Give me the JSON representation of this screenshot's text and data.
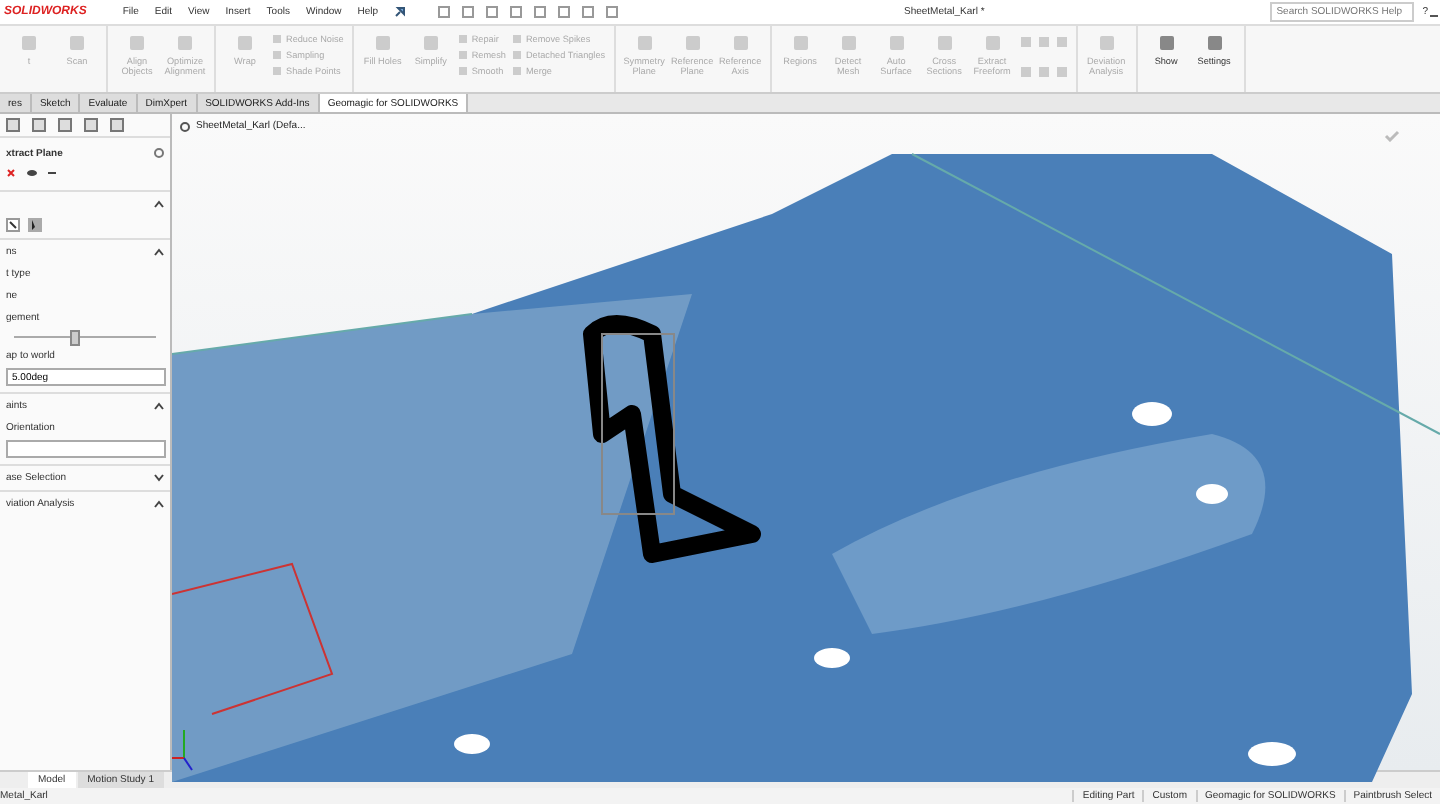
{
  "title_bar": {
    "logo": "SOLIDWORKS",
    "menu": [
      "File",
      "Edit",
      "View",
      "Insert",
      "Tools",
      "Window",
      "Help"
    ],
    "document_title": "SheetMetal_Karl *",
    "search": {
      "placeholder": "Search SOLIDWORKS Help"
    },
    "help": "?"
  },
  "ribbon": {
    "groups": [
      {
        "items": [
          {
            "kind": "large",
            "label": "t",
            "disabled": true
          },
          {
            "kind": "large",
            "label": "Scan",
            "disabled": true
          }
        ]
      },
      {
        "items": [
          {
            "kind": "large",
            "label": "Align Objects",
            "disabled": true
          },
          {
            "kind": "large",
            "label": "Optimize Alignment",
            "disabled": true
          }
        ]
      },
      {
        "items": [
          {
            "kind": "large",
            "label": "Wrap",
            "disabled": true
          },
          {
            "kind": "stack",
            "labels": [
              "Reduce Noise",
              "Sampling",
              "Shade Points"
            ],
            "disabled": true
          }
        ]
      },
      {
        "items": [
          {
            "kind": "large",
            "label": "Fill Holes",
            "disabled": true
          },
          {
            "kind": "large",
            "label": "Simplify",
            "disabled": true
          },
          {
            "kind": "stack",
            "labels": [
              "Repair",
              "Remesh",
              "Smooth"
            ],
            "disabled": true
          },
          {
            "kind": "stack",
            "labels": [
              "Remove Spikes",
              "Detached Triangles",
              "Merge"
            ],
            "disabled": true
          }
        ]
      },
      {
        "items": [
          {
            "kind": "large",
            "label": "Symmetry Plane",
            "disabled": true
          },
          {
            "kind": "large",
            "label": "Reference Plane",
            "disabled": true
          },
          {
            "kind": "large",
            "label": "Reference Axis",
            "disabled": true
          }
        ]
      },
      {
        "items": [
          {
            "kind": "large",
            "label": "Regions",
            "disabled": true
          },
          {
            "kind": "large",
            "label": "Detect Mesh",
            "disabled": true
          },
          {
            "kind": "large",
            "label": "Auto Surface",
            "disabled": true
          },
          {
            "kind": "large",
            "label": "Cross Sections",
            "disabled": true
          },
          {
            "kind": "large",
            "label": "Extract Freeform",
            "disabled": true
          },
          {
            "kind": "icons",
            "disabled": true
          }
        ]
      },
      {
        "items": [
          {
            "kind": "large",
            "label": "Deviation Analysis",
            "disabled": true
          }
        ]
      },
      {
        "items": [
          {
            "kind": "large",
            "label": "Show",
            "disabled": false
          },
          {
            "kind": "large",
            "label": "Settings",
            "disabled": false
          }
        ]
      }
    ]
  },
  "command_tabs": [
    {
      "label": "res",
      "selected": false
    },
    {
      "label": "Sketch",
      "selected": false
    },
    {
      "label": "Evaluate",
      "selected": false
    },
    {
      "label": "DimXpert",
      "selected": false
    },
    {
      "label": "SOLIDWORKS Add-Ins",
      "selected": false
    },
    {
      "label": "Geomagic for SOLIDWORKS",
      "selected": true
    }
  ],
  "property_panel": {
    "title": "xtract Plane",
    "sections": [
      {
        "expanded": true
      },
      {
        "title": "ns",
        "expanded": true,
        "rows": [
          {
            "kind": "label",
            "text": "t type"
          },
          {
            "kind": "label",
            "text": "ne"
          },
          {
            "kind": "label",
            "text": "gement"
          },
          {
            "kind": "slider",
            "level": 0.4
          },
          {
            "kind": "label",
            "text": "ap to world"
          },
          {
            "kind": "field",
            "value": "5.00deg"
          }
        ]
      },
      {
        "title": "aints",
        "expanded": true,
        "rows": [
          {
            "kind": "label",
            "text": "Orientation"
          },
          {
            "kind": "field",
            "value": ""
          }
        ]
      },
      {
        "title": "ase Selection",
        "expanded": false
      },
      {
        "title": "viation Analysis",
        "expanded": true
      }
    ]
  },
  "viewport": {
    "tree_item": "SheetMetal_Karl  (Defa..."
  },
  "bottom_tabs": [
    {
      "label": "Model",
      "selected": true
    },
    {
      "label": "Motion Study 1",
      "selected": false
    }
  ],
  "status_bar": {
    "document": "Metal_Karl",
    "fields": [
      "Editing Part",
      "Custom",
      "Geomagic for SOLIDWORKS",
      "Paintbrush Select"
    ]
  }
}
